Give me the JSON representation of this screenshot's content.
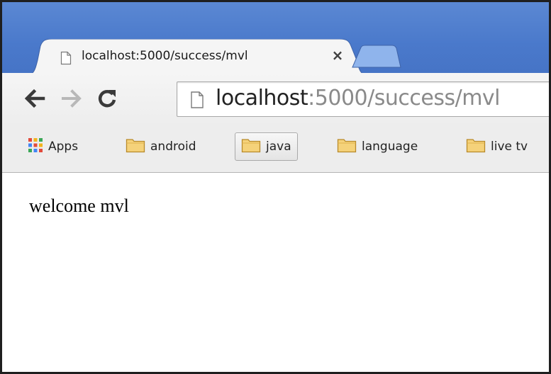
{
  "tab": {
    "title": "localhost:5000/success/mvl",
    "close_glyph": "×"
  },
  "toolbar": {
    "back_icon": "back-arrow-icon",
    "forward_icon": "forward-arrow-icon",
    "reload_icon": "reload-icon"
  },
  "omnibox": {
    "host": "localhost",
    "rest": ":5000/success/mvl"
  },
  "bookmarks": {
    "items": [
      {
        "label": "Apps",
        "icon": "apps-grid-icon"
      },
      {
        "label": "android",
        "icon": "folder-icon"
      },
      {
        "label": "java",
        "icon": "folder-icon"
      },
      {
        "label": "language",
        "icon": "folder-icon"
      },
      {
        "label": "live tv",
        "icon": "folder-icon"
      }
    ]
  },
  "page": {
    "text": "welcome mvl"
  },
  "colors": {
    "titlebar": "#4a79cb",
    "new_tab": "#8fb4ec",
    "folder_fill": "#f5d27a",
    "folder_stroke": "#b88a2a"
  }
}
